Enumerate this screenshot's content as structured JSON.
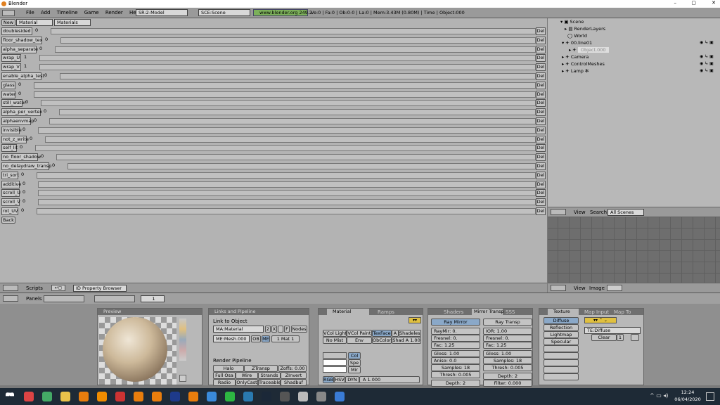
{
  "window": {
    "title": "Blender",
    "minimize": "–",
    "maximize": "▢",
    "close": "✕"
  },
  "menu": {
    "items": [
      "File",
      "Add",
      "Timeline",
      "Game",
      "Render",
      "Help"
    ],
    "screen": "SR:2-Model",
    "scene": "SCE:Scene",
    "url": "www.blender.org 249.2",
    "stats": "Ve:0 | Fa:0 | Ob:0-0 | La:0 | Mem:3.43M (0.80M) | Time | Object:000"
  },
  "propbrowser": {
    "new_label": "New",
    "type": "Material",
    "category": "Materials",
    "del_label": "Del",
    "back_label": "Back",
    "rows": [
      {
        "name": "doublesided",
        "value": "0"
      },
      {
        "name": "floor_shadow_tex",
        "value": "0"
      },
      {
        "name": "alpha_separate",
        "value": "0"
      },
      {
        "name": "wrap_U",
        "value": "1"
      },
      {
        "name": "wrap_V",
        "value": "1"
      },
      {
        "name": "enable_alpha_test",
        "value": "0"
      },
      {
        "name": "glass",
        "value": "0"
      },
      {
        "name": "water",
        "value": "0"
      },
      {
        "name": "still_water",
        "value": "0"
      },
      {
        "name": "alpha_per_vertex",
        "value": "0"
      },
      {
        "name": "alphaenvmap",
        "value": "0"
      },
      {
        "name": "invisible",
        "value": "0"
      },
      {
        "name": "not_z_write",
        "value": "0"
      },
      {
        "name": "self_lit",
        "value": "0"
      },
      {
        "name": "no_floor_shadow",
        "value": "0"
      },
      {
        "name": "no_delaydraw_transp",
        "value": "0"
      },
      {
        "name": "tri_sort",
        "value": "0"
      },
      {
        "name": "additive",
        "value": "0"
      },
      {
        "name": "scroll_U",
        "value": "0"
      },
      {
        "name": "scroll_V",
        "value": "0"
      },
      {
        "name": "rot_UV",
        "value": "0"
      }
    ]
  },
  "outliner": {
    "items": [
      "Scene",
      "RenderLayers",
      "World",
      "00.line01",
      "Object.000",
      "Camera",
      "ControlMeshes",
      "Lamp"
    ],
    "view": "View",
    "search": "Search",
    "scenes": "All Scenes"
  },
  "imageheader": {
    "view": "View",
    "image": "Image"
  },
  "scriptheader": {
    "scripts": "Scripts",
    "browser": "ID Property Browser"
  },
  "buttonsheader": {
    "panels": "Panels",
    "frame": "1"
  },
  "preview": {
    "title": "Preview"
  },
  "links": {
    "title": "Links and Pipeline",
    "link_to": "Link to Object",
    "ma": "MA:Material",
    "users": "2",
    "me": "ME:Mesh.000",
    "ob": "OB",
    "me_btn": "ME",
    "mat_count": "1 Mat 1",
    "nodes": "Nodes",
    "f": "F",
    "x": "X",
    "pipeline": "Render Pipeline",
    "halo": "Halo",
    "ztransp": "ZTransp",
    "zoffs": "Zoffs: 0.00",
    "fullosa": "Full Osa",
    "wire": "Wire",
    "strands": "Strands",
    "zinvert": "ZInvert",
    "radio": "Radio",
    "onlycast": "OnlyCast",
    "traceable": "Traceable",
    "shadbuf": "Shadbuf"
  },
  "material": {
    "tab1": "Material",
    "tab2": "Ramps",
    "vcollight": "VCol Light",
    "vcolpaint": "VCol Paint",
    "texface": "TexFace",
    "a": "A",
    "shadeless": "Shadeless",
    "nomist": "No Mist",
    "env": "Env",
    "obcolor": "ObColor",
    "shad_a": "Shad A 1.00",
    "col": "Col",
    "spe": "Spe",
    "mir": "Mir",
    "rgb": "RGB",
    "hsv": "HSV",
    "dyn": "DYN",
    "a_val": "A 1.000"
  },
  "mirror": {
    "tab1": "Shaders",
    "tab2": "Mirror Transp",
    "tab3": "SSS",
    "raymirror": "Ray Mirror",
    "raytransp": "Ray Transp",
    "raymir": "RayMir: 0.",
    "fresnel": "Fresnel: 0.",
    "fac": "Fac: 1.25",
    "gloss": "Gloss: 1.00",
    "aniso": "Aniso: 0.0",
    "samples": "Samples: 18",
    "thresh": "Thresh: 0.005",
    "depth": "Depth: 2",
    "ior": "IOR: 1.00",
    "fresnel2": "Fresnel: 0.",
    "fac2": "Fac: 1.25",
    "gloss2": "Gloss: 1.00",
    "samples2": "Samples: 18",
    "thresh2": "Thresh: 0.005",
    "depth2": "Depth: 2",
    "filter": "Filter: 0.000"
  },
  "texture": {
    "tab1": "Texture",
    "tab2": "Map Input",
    "tab3": "Map To",
    "channels": [
      "Diffuse",
      "Reflection",
      "Lightmap",
      "Specular"
    ],
    "te": "TE:Diffuse",
    "clear": "Clear",
    "users": "1"
  },
  "taskbar": {
    "time": "12:24",
    "date": "06/04/2020"
  }
}
